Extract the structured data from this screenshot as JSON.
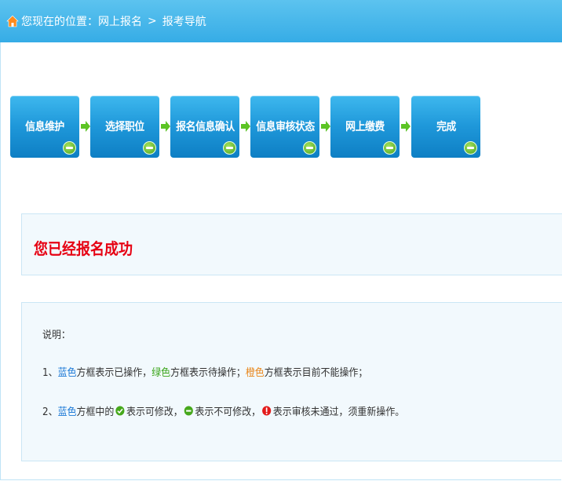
{
  "breadcrumb": {
    "location_label": "您现在的位置：",
    "items": [
      "网上报名",
      "报考导航"
    ],
    "separator": ">"
  },
  "steps": [
    {
      "label": "信息维护",
      "status": "green-minus"
    },
    {
      "label": "选择职位",
      "status": "green-minus"
    },
    {
      "label": "报名信息确认",
      "status": "green-minus"
    },
    {
      "label": "信息审核状态",
      "status": "green-minus"
    },
    {
      "label": "网上缴费",
      "status": "green-minus"
    },
    {
      "label": "完成",
      "status": "green-minus"
    }
  ],
  "success": {
    "message": "您已经报名成功"
  },
  "notes": {
    "title": "说明：",
    "line1": {
      "prefix": "1、",
      "blue": "蓝色",
      "t1": "方框表示已操作，",
      "green": "绿色",
      "t2": "方框表示待操作；",
      "orange": "橙色",
      "t3": "方框表示目前不能操作；"
    },
    "line2": {
      "prefix": "2、",
      "blue": "蓝色",
      "t1": "方框中的",
      "t2": "表示可修改，",
      "t3": "表示不可修改，",
      "t4": "表示审核未通过，须重新操作。"
    }
  },
  "colors": {
    "header_bg": "#36ace6",
    "step_bg": "#1f98da",
    "success_text": "#e60012",
    "panel_bg": "#f2f9fd"
  }
}
